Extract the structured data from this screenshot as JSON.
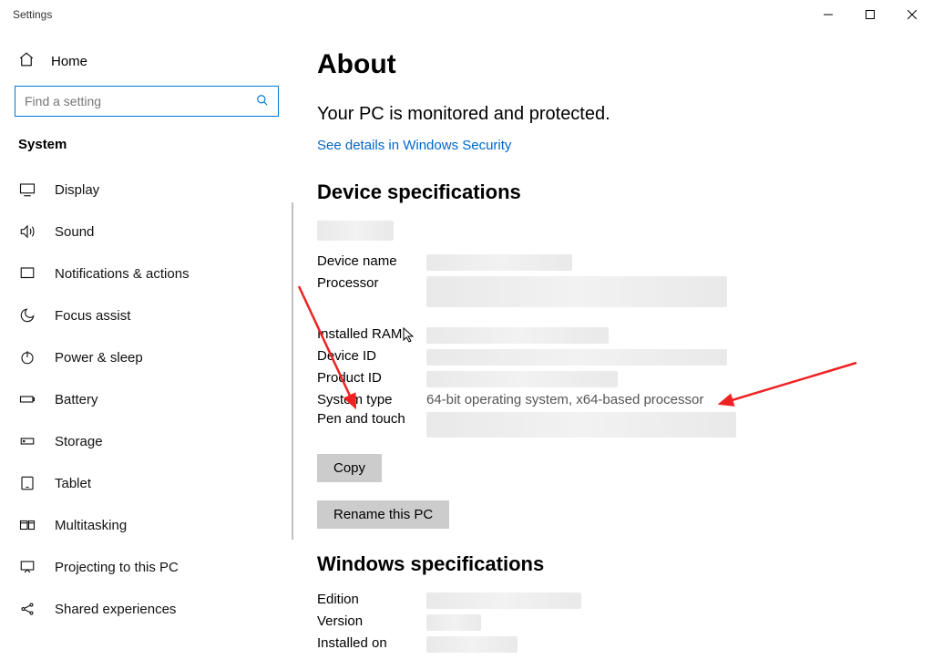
{
  "window": {
    "title": "Settings"
  },
  "sidebar": {
    "home_label": "Home",
    "search_placeholder": "Find a setting",
    "section": "System",
    "items": [
      {
        "label": "Display",
        "icon": "display-icon"
      },
      {
        "label": "Sound",
        "icon": "sound-icon"
      },
      {
        "label": "Notifications & actions",
        "icon": "notifications-icon"
      },
      {
        "label": "Focus assist",
        "icon": "moon-icon"
      },
      {
        "label": "Power & sleep",
        "icon": "power-icon"
      },
      {
        "label": "Battery",
        "icon": "battery-icon"
      },
      {
        "label": "Storage",
        "icon": "storage-icon"
      },
      {
        "label": "Tablet",
        "icon": "tablet-icon"
      },
      {
        "label": "Multitasking",
        "icon": "multitasking-icon"
      },
      {
        "label": "Projecting to this PC",
        "icon": "projecting-icon"
      },
      {
        "label": "Shared experiences",
        "icon": "shared-icon"
      }
    ]
  },
  "main": {
    "title": "About",
    "protect_line": "Your PC is monitored and protected.",
    "security_link": "See details in Windows Security",
    "device_section": "Device specifications",
    "device_rows": {
      "device_name": "Device name",
      "processor": "Processor",
      "installed_ram": "Installed RAM",
      "device_id": "Device ID",
      "product_id": "Product ID",
      "system_type": "System type",
      "system_type_value": "64-bit operating system, x64-based processor",
      "pen_touch": "Pen and touch"
    },
    "copy_button": "Copy",
    "rename_button": "Rename this PC",
    "win_section": "Windows specifications",
    "win_rows": {
      "edition": "Edition",
      "version": "Version",
      "installed_on": "Installed on"
    }
  }
}
